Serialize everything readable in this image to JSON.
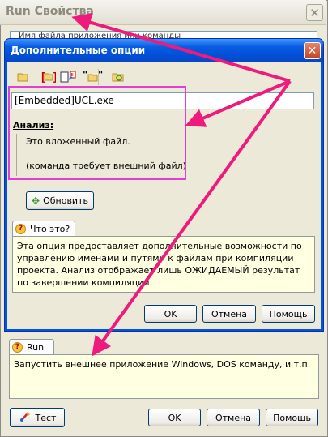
{
  "outer": {
    "title": "Run Свойства",
    "field_text": "Имя файла приложения или команды",
    "help_tab": "Run",
    "help_text": "Запустить внешнее приложение Windows, DOS команду, и т.п.",
    "test_label": "Тест",
    "ok_label": "OK",
    "cancel_label": "Отмена",
    "help_label": "Помощь"
  },
  "inner": {
    "title": "Дополнительные опции",
    "path_value": "[Embedded]UCL.exe",
    "analysis_label": "Анализ:",
    "analysis_line1": "Это вложенный файл.",
    "analysis_line2": "(команда требует внешний файл)",
    "refresh_label": "Обновить",
    "help_tab": "Что это?",
    "help_text": "Эта опция предоставляет дополнительные возможности по управлению именами и путями к файлам при компиляции проекта. Анализ отображает лишь ОЖИДАЕМЫЙ результат по завершении компиляции.",
    "ok_label": "OK",
    "cancel_label": "Отмена",
    "help_label": "Помощь"
  },
  "colors": {
    "accent": "#0054e3",
    "highlight": "#e040d0",
    "arrow": "#ee1a7c",
    "help_bg": "#ffffe1"
  },
  "icons": [
    "folder-icon",
    "bracket-insert-icon",
    "embedded-file-icon",
    "quote-folder-icon",
    "refresh-folder-icon",
    "close-icon",
    "question-icon",
    "refresh-icon",
    "test-icon"
  ]
}
